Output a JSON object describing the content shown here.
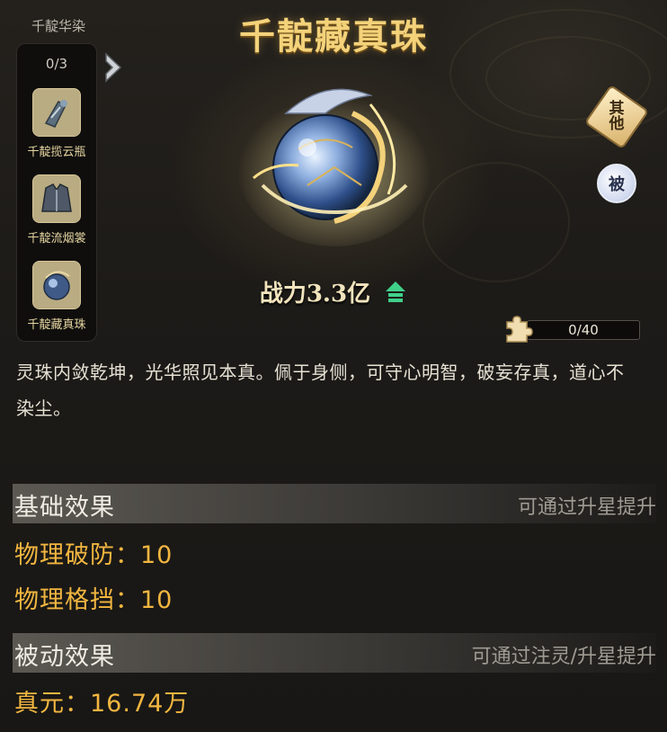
{
  "set_panel": {
    "title": "千靛华染",
    "count": "0/3",
    "items": [
      {
        "label": "千靛揽云瓶",
        "icon": "vase-icon"
      },
      {
        "label": "千靛流烟裳",
        "icon": "robe-icon"
      },
      {
        "label": "千靛藏真珠",
        "icon": "pearl-icon"
      }
    ]
  },
  "item": {
    "name": "千靛藏真珠",
    "power_label": "战力3.3亿",
    "description": "灵珠内敛乾坤，光华照见本真。佩于身侧，可守心明智，破妄存真，道心不染尘。"
  },
  "side_buttons": {
    "other_label": "其他",
    "passive_label": "被"
  },
  "fragments": {
    "text": "0/40",
    "progress": 0
  },
  "base_effects": {
    "title": "基础效果",
    "hint": "可通过升星提升",
    "stats": [
      "物理破防：10",
      "物理格挡：10"
    ]
  },
  "passive_effects": {
    "title": "被动效果",
    "hint": "可通过注灵/升星提升",
    "stats": [
      "真元：16.74万"
    ]
  },
  "colors": {
    "title_gold": "#f4d27a",
    "stat_orange": "#f2b640",
    "upgrade_green": "#3fd08a"
  }
}
